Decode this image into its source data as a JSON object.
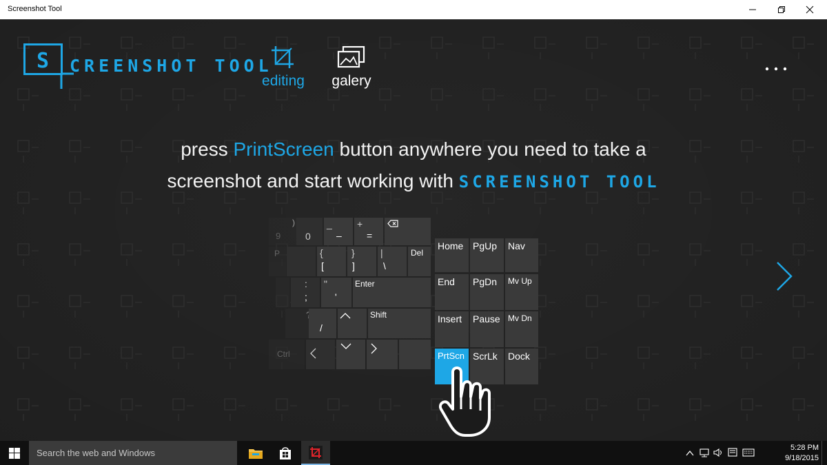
{
  "window": {
    "title": "Screenshot Tool"
  },
  "app": {
    "logo_letter": "S",
    "logo_text": "CREENSHOT TOOL",
    "nav": [
      {
        "label": "editing",
        "icon": "crop-icon",
        "active": true
      },
      {
        "label": "galery",
        "icon": "gallery-icon",
        "active": false
      }
    ],
    "headline": {
      "part1": "press ",
      "accent": "PrintScreen",
      "part2": " button anywhere you need to take a",
      "part3": "screenshot and start working with ",
      "brand": "SCREENSHOT TOOL"
    },
    "accent_color": "#1ea7e6"
  },
  "keyboard": {
    "main_keys": {
      "k9": "9",
      "kparen": ")",
      "k0": "0",
      "kunder": "_",
      "kminus": "–",
      "kplus": "+",
      "keq": "=",
      "kp": "P",
      "klbrace": "{",
      "klbr": "[",
      "krbrace": "}",
      "krbr": "]",
      "kpipe": "|",
      "kbslash": "\\",
      "kdel": "Del",
      "kcolon": ":",
      "ksemi": ";",
      "kquote": "\"",
      "kapos": "'",
      "kenter": "Enter",
      "kq": "?",
      "kslash": "/",
      "kshift": "Shift",
      "kctrl": "Ctrl"
    },
    "nav_keys": [
      "Home",
      "PgUp",
      "Nav",
      "End",
      "PgDn",
      "Mv Up",
      "Insert",
      "Pause",
      "Mv Dn",
      "PrtScn",
      "ScrLk",
      "Dock"
    ],
    "active_key": "PrtScn"
  },
  "taskbar": {
    "search_placeholder": "Search the web and Windows",
    "apps": [
      "file-explorer-icon",
      "store-icon",
      "screenshot-tool-icon"
    ],
    "time": "5:28 PM",
    "date": "9/18/2015"
  }
}
